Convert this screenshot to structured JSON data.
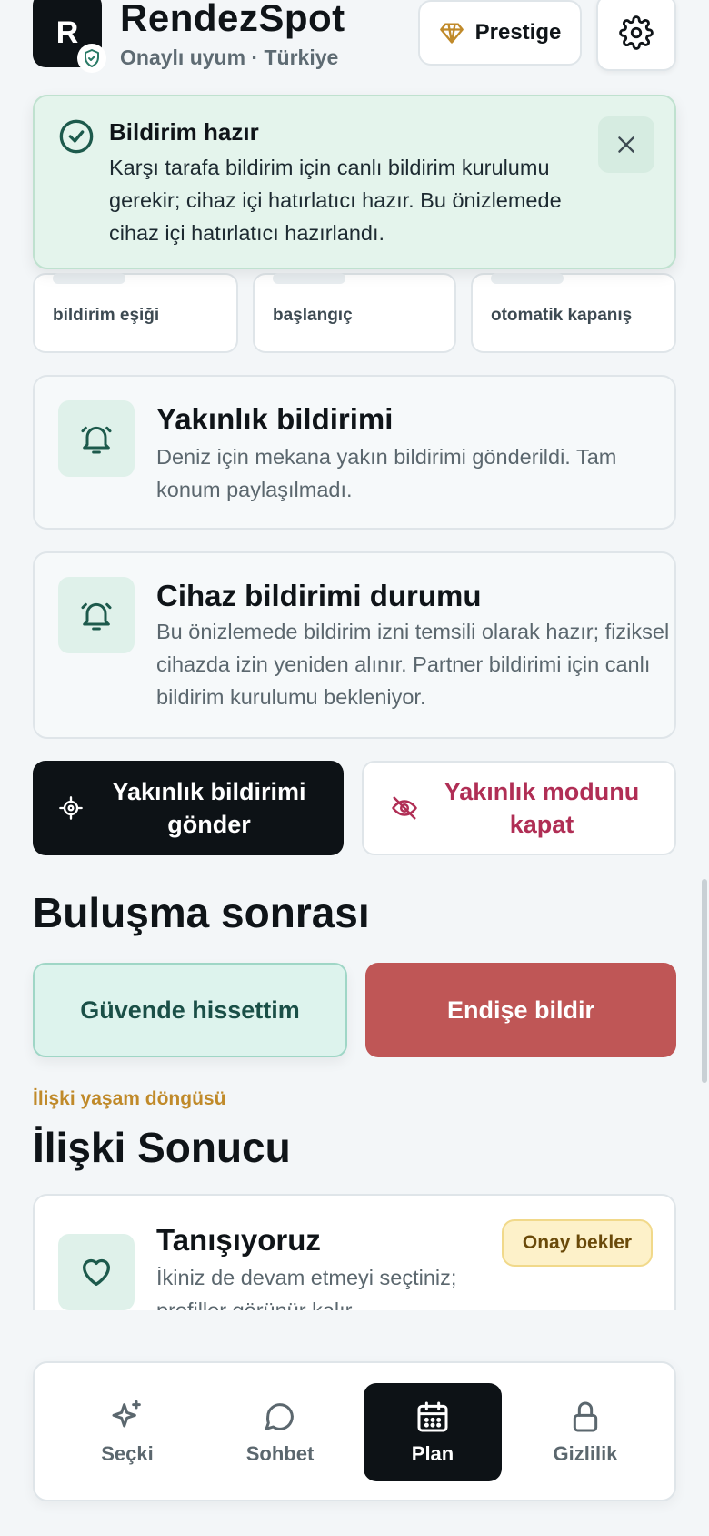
{
  "header": {
    "logo_letter": "R",
    "app_name": "RendezSpot",
    "subtitle": "Onaylı uyum · Türkiye",
    "prestige_label": "Prestige"
  },
  "toast": {
    "title": "Bildirim hazır",
    "body": "Karşı tarafa bildirim için canlı bildirim kurulumu gerekir; cihaz içi hatırlatıcı hazır. Bu önizlemede cihaz içi hatırlatıcı hazırlandı."
  },
  "metrics": [
    {
      "label": "bildirim eşiği"
    },
    {
      "label": "başlangıç"
    },
    {
      "label": "otomatik kapanış"
    }
  ],
  "cards": {
    "proximity": {
      "title": "Yakınlık bildirimi",
      "text": "Deniz için mekana yakın bildirimi gönderildi. Tam konum paylaşılmadı."
    },
    "device": {
      "title": "Cihaz bildirimi durumu",
      "text": "Bu önizlemede bildirim izni temsili olarak hazır; fiziksel cihazda izin yeniden alınır. Partner bildirimi için canlı bildirim kurulumu bekleniyor."
    }
  },
  "actions": {
    "send_proximity": "Yakınlık bildirimi gönder",
    "disable_proximity": "Yakınlık modunu kapat"
  },
  "after_meeting": {
    "title": "Buluşma sonrası",
    "safe_label": "Güvende hissettim",
    "concern_label": "Endişe bildir"
  },
  "relationship": {
    "eyebrow": "İlişki yaşam döngüsü",
    "title": "İlişki Sonucu",
    "status_title": "Tanışıyoruz",
    "status_text": "İkiniz de devam etmeyi seçtiniz; profiller görünür kalır.",
    "badge": "Onay bekler"
  },
  "nav": {
    "items": [
      {
        "label": "Seçki",
        "icon": "sparkle-icon"
      },
      {
        "label": "Sohbet",
        "icon": "chat-icon"
      },
      {
        "label": "Plan",
        "icon": "calendar-icon",
        "active": true
      },
      {
        "label": "Gizlilik",
        "icon": "lock-icon"
      }
    ]
  },
  "colors": {
    "accent_dark": "#0d1216",
    "success_bg": "#e4f4ec",
    "danger": "#bf5656",
    "rose_text": "#b02e55",
    "gold": "#c08a2a"
  }
}
